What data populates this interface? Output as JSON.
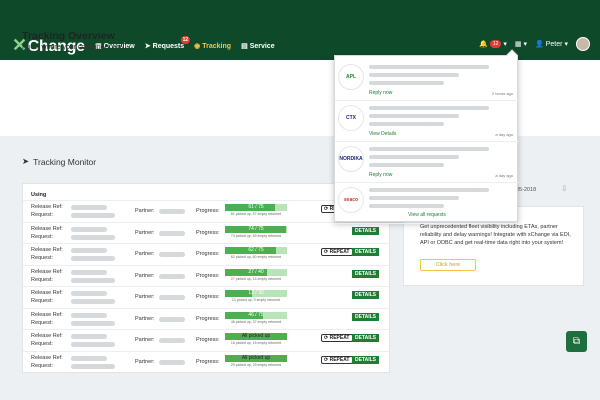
{
  "app": {
    "logo_mark": "✕",
    "logo_text": "Change"
  },
  "nav": {
    "items": [
      {
        "label": "Overview",
        "icon": "dashboard-icon"
      },
      {
        "label": "Requests",
        "icon": "send-icon",
        "badge": "12"
      },
      {
        "label": "Tracking",
        "icon": "compass-icon",
        "active": true
      },
      {
        "label": "Service",
        "icon": "id-card-icon"
      }
    ],
    "bell_badge": "12",
    "user_name": "Peter"
  },
  "page": {
    "title": "Tracking Overview",
    "subtitle": "Know where your containers are!"
  },
  "monitor": {
    "title": "Tracking Monitor",
    "using_label": "Using",
    "labels": {
      "release_ref": "Release Ref:",
      "request": "Request:",
      "partner": "Partner:",
      "progress": "Progress:"
    },
    "rows": [
      {
        "progress_text": "61 / 75",
        "fraction": 0.81,
        "sub": "61 picked up, 57 empty returned",
        "repeat": "REPEAT",
        "details": "DETAILS"
      },
      {
        "progress_text": "74 / 75",
        "fraction": 0.99,
        "sub": "74 picked up, 69 empty returned",
        "repeat": "",
        "details": "DETAILS"
      },
      {
        "progress_text": "62 / 75",
        "fraction": 0.83,
        "sub": "62 picked up, 60 empty returned",
        "repeat": "REPEAT",
        "details": "DETAILS"
      },
      {
        "progress_text": "27 / 40",
        "fraction": 0.68,
        "sub": "27 picked up, 14 empty returned",
        "repeat": "",
        "details": "DETAILS"
      },
      {
        "progress_text": "13 / 30",
        "fraction": 0.43,
        "sub": "13 picked up, 9 empty returned",
        "repeat": "",
        "details": "DETAILS"
      },
      {
        "progress_text": "46 / 75",
        "fraction": 0.61,
        "sub": "46 picked up, 37 empty returned",
        "repeat": "",
        "details": "DETAILS"
      },
      {
        "progress_text": "All picked up",
        "fraction": 1.0,
        "sub": "16 picked up, 16 empty returned",
        "repeat": "REPEAT",
        "details": "DETAILS"
      },
      {
        "progress_text": "All picked up",
        "fraction": 1.0,
        "sub": "29 picked up, 29 empty returned",
        "repeat": "REPEAT",
        "details": "DETAILS"
      }
    ]
  },
  "side_panel": {
    "date_text": "05-2018",
    "text": "Get unprecedented fleet visibility including ETAs, partner reliability and delay warnings! Integrate with xChange via EDI, API or ODBC and get real-time data right into your system!",
    "button": "Click here"
  },
  "notifications": {
    "items": [
      {
        "logo": "APL",
        "action": "Reply now",
        "time": "2 hours ago"
      },
      {
        "logo": "CTX",
        "action": "View Details",
        "time": "a day ago"
      },
      {
        "logo": "NORDIKA",
        "action": "Reply now",
        "time": "a day ago"
      },
      {
        "logo": "seaco",
        "action": "",
        "time": ""
      }
    ],
    "view_all": "View all requests"
  },
  "colors": {
    "brand_dark": "#0e4a2a",
    "accent": "#f6c34a",
    "progress": "#4caf50",
    "details": "#1e7e34"
  }
}
